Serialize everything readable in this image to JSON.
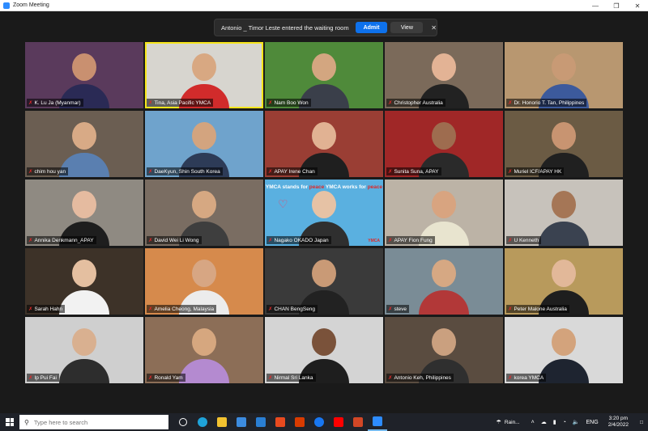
{
  "window": {
    "title": "Zoom Meeting",
    "minimize": "—",
    "maximize": "❐",
    "close": "✕"
  },
  "notification": {
    "message": "Antonio _ Timor Leste entered the waiting room",
    "admit": "Admit",
    "view": "View",
    "close": "✕"
  },
  "participants": [
    {
      "name": "K. Lu Ja (Myanmar)",
      "bg": "#5a3a5c",
      "skin": "#c99070",
      "shirt": "#2a2a55"
    },
    {
      "name": "Tina, Asia Pacific YMCA",
      "bg": "#d7d5cf",
      "skin": "#d8a882",
      "shirt": "#d12b2b",
      "active": true
    },
    {
      "name": "Nam Boo Won",
      "bg": "#4f8a3a",
      "skin": "#d3a680",
      "shirt": "#3a3f4a"
    },
    {
      "name": "Christopher  Australia",
      "bg": "#7b6a5a",
      "skin": "#e3b395",
      "shirt": "#222"
    },
    {
      "name": "Dr. Honorio T. Tan, Philippines",
      "bg": "#b89770",
      "skin": "#c89a75",
      "shirt": "#3c5a9c"
    },
    {
      "name": "chim hou yan",
      "bg": "#6b5e52",
      "skin": "#d8aa86",
      "shirt": "#5a7fb0"
    },
    {
      "name": "DaeKyun, Shin South Korea",
      "bg": "#6fa3cc",
      "skin": "#d3a47f",
      "shirt": "#2d3b57"
    },
    {
      "name": "APAY Irene Chan",
      "bg": "#9a3e34",
      "skin": "#e1b293",
      "shirt": "#1f1f1f"
    },
    {
      "name": "Sunita Suna, APAY",
      "bg": "#a02727",
      "skin": "#9e6c4f",
      "shirt": "#2a2a2a"
    },
    {
      "name": "Muriel ICF/APAY HK",
      "bg": "#6b5b44",
      "skin": "#c89471",
      "shirt": "#202020"
    },
    {
      "name": "Annika Denkmann_APAY",
      "bg": "#8f8a82",
      "skin": "#e5bba0",
      "shirt": "#1e1e1e"
    },
    {
      "name": "David Wei Li Wong",
      "bg": "#7a6d62",
      "skin": "#d6a882",
      "shirt": "#3e3e3e"
    },
    {
      "name": "Nagako OKADO Japan",
      "bg": "#5ab0e0",
      "skin": "#e6c2a5",
      "shirt": "#2f2f2f",
      "ymca": true
    },
    {
      "name": "APAY Fion Fung",
      "bg": "#bcb3a6",
      "skin": "#d8a480",
      "shirt": "#e8e4cf"
    },
    {
      "name": "U Kenneth",
      "bg": "#c7c2bb",
      "skin": "#a57656",
      "shirt": "#3a4250"
    },
    {
      "name": "Sarah Hahn",
      "bg": "#3d3228",
      "skin": "#e4bfa0",
      "shirt": "#f2f2f2"
    },
    {
      "name": "Amelia Cheong, Malaysia",
      "bg": "#d68a4c",
      "skin": "#d7a683",
      "shirt": "#ececec"
    },
    {
      "name": "CHAN BengSeng",
      "bg": "#3a3a3a",
      "skin": "#c99a76",
      "shirt": "#222"
    },
    {
      "name": "steve",
      "bg": "#7a8c96",
      "skin": "#d6a883",
      "shirt": "#b23838"
    },
    {
      "name": "Peter Malone  Australia",
      "bg": "#b89a5c",
      "skin": "#e2b899",
      "shirt": "#1e1e1e"
    },
    {
      "name": "Ip Pui Fai",
      "bg": "#cfcfcf",
      "skin": "#d9b090",
      "shirt": "#2d2d2d"
    },
    {
      "name": "Ronald Yam",
      "bg": "#8c6e57",
      "skin": "#d6a77f",
      "shirt": "#b48ad0"
    },
    {
      "name": "Nirmal Sri Lanka",
      "bg": "#d4d4d4",
      "skin": "#7a523a",
      "shirt": "#1e1e1e"
    },
    {
      "name": "Antonio Keh, Philippines",
      "bg": "#5a4c40",
      "skin": "#caa07f",
      "shirt": "#2f2f2f"
    },
    {
      "name": "korea YMCA",
      "bg": "#d9d9d9",
      "skin": "#d3a37c",
      "shirt": "#1e2430"
    }
  ],
  "ymca_banner": {
    "part1": "YMCA stands for ",
    "peace1": "peace",
    "part2": " YMCA works for ",
    "peace2": "peace",
    "logo": "YMCA"
  },
  "taskbar": {
    "search_placeholder": "Type here to search",
    "apps": [
      "task-view",
      "edge",
      "file-explorer",
      "store",
      "mail",
      "office",
      "word",
      "facebook",
      "youtube",
      "powerpoint",
      "zoom"
    ],
    "weather": "Rain...",
    "language": "ENG",
    "time": "3:20 pm",
    "date": "2/4/2022"
  }
}
